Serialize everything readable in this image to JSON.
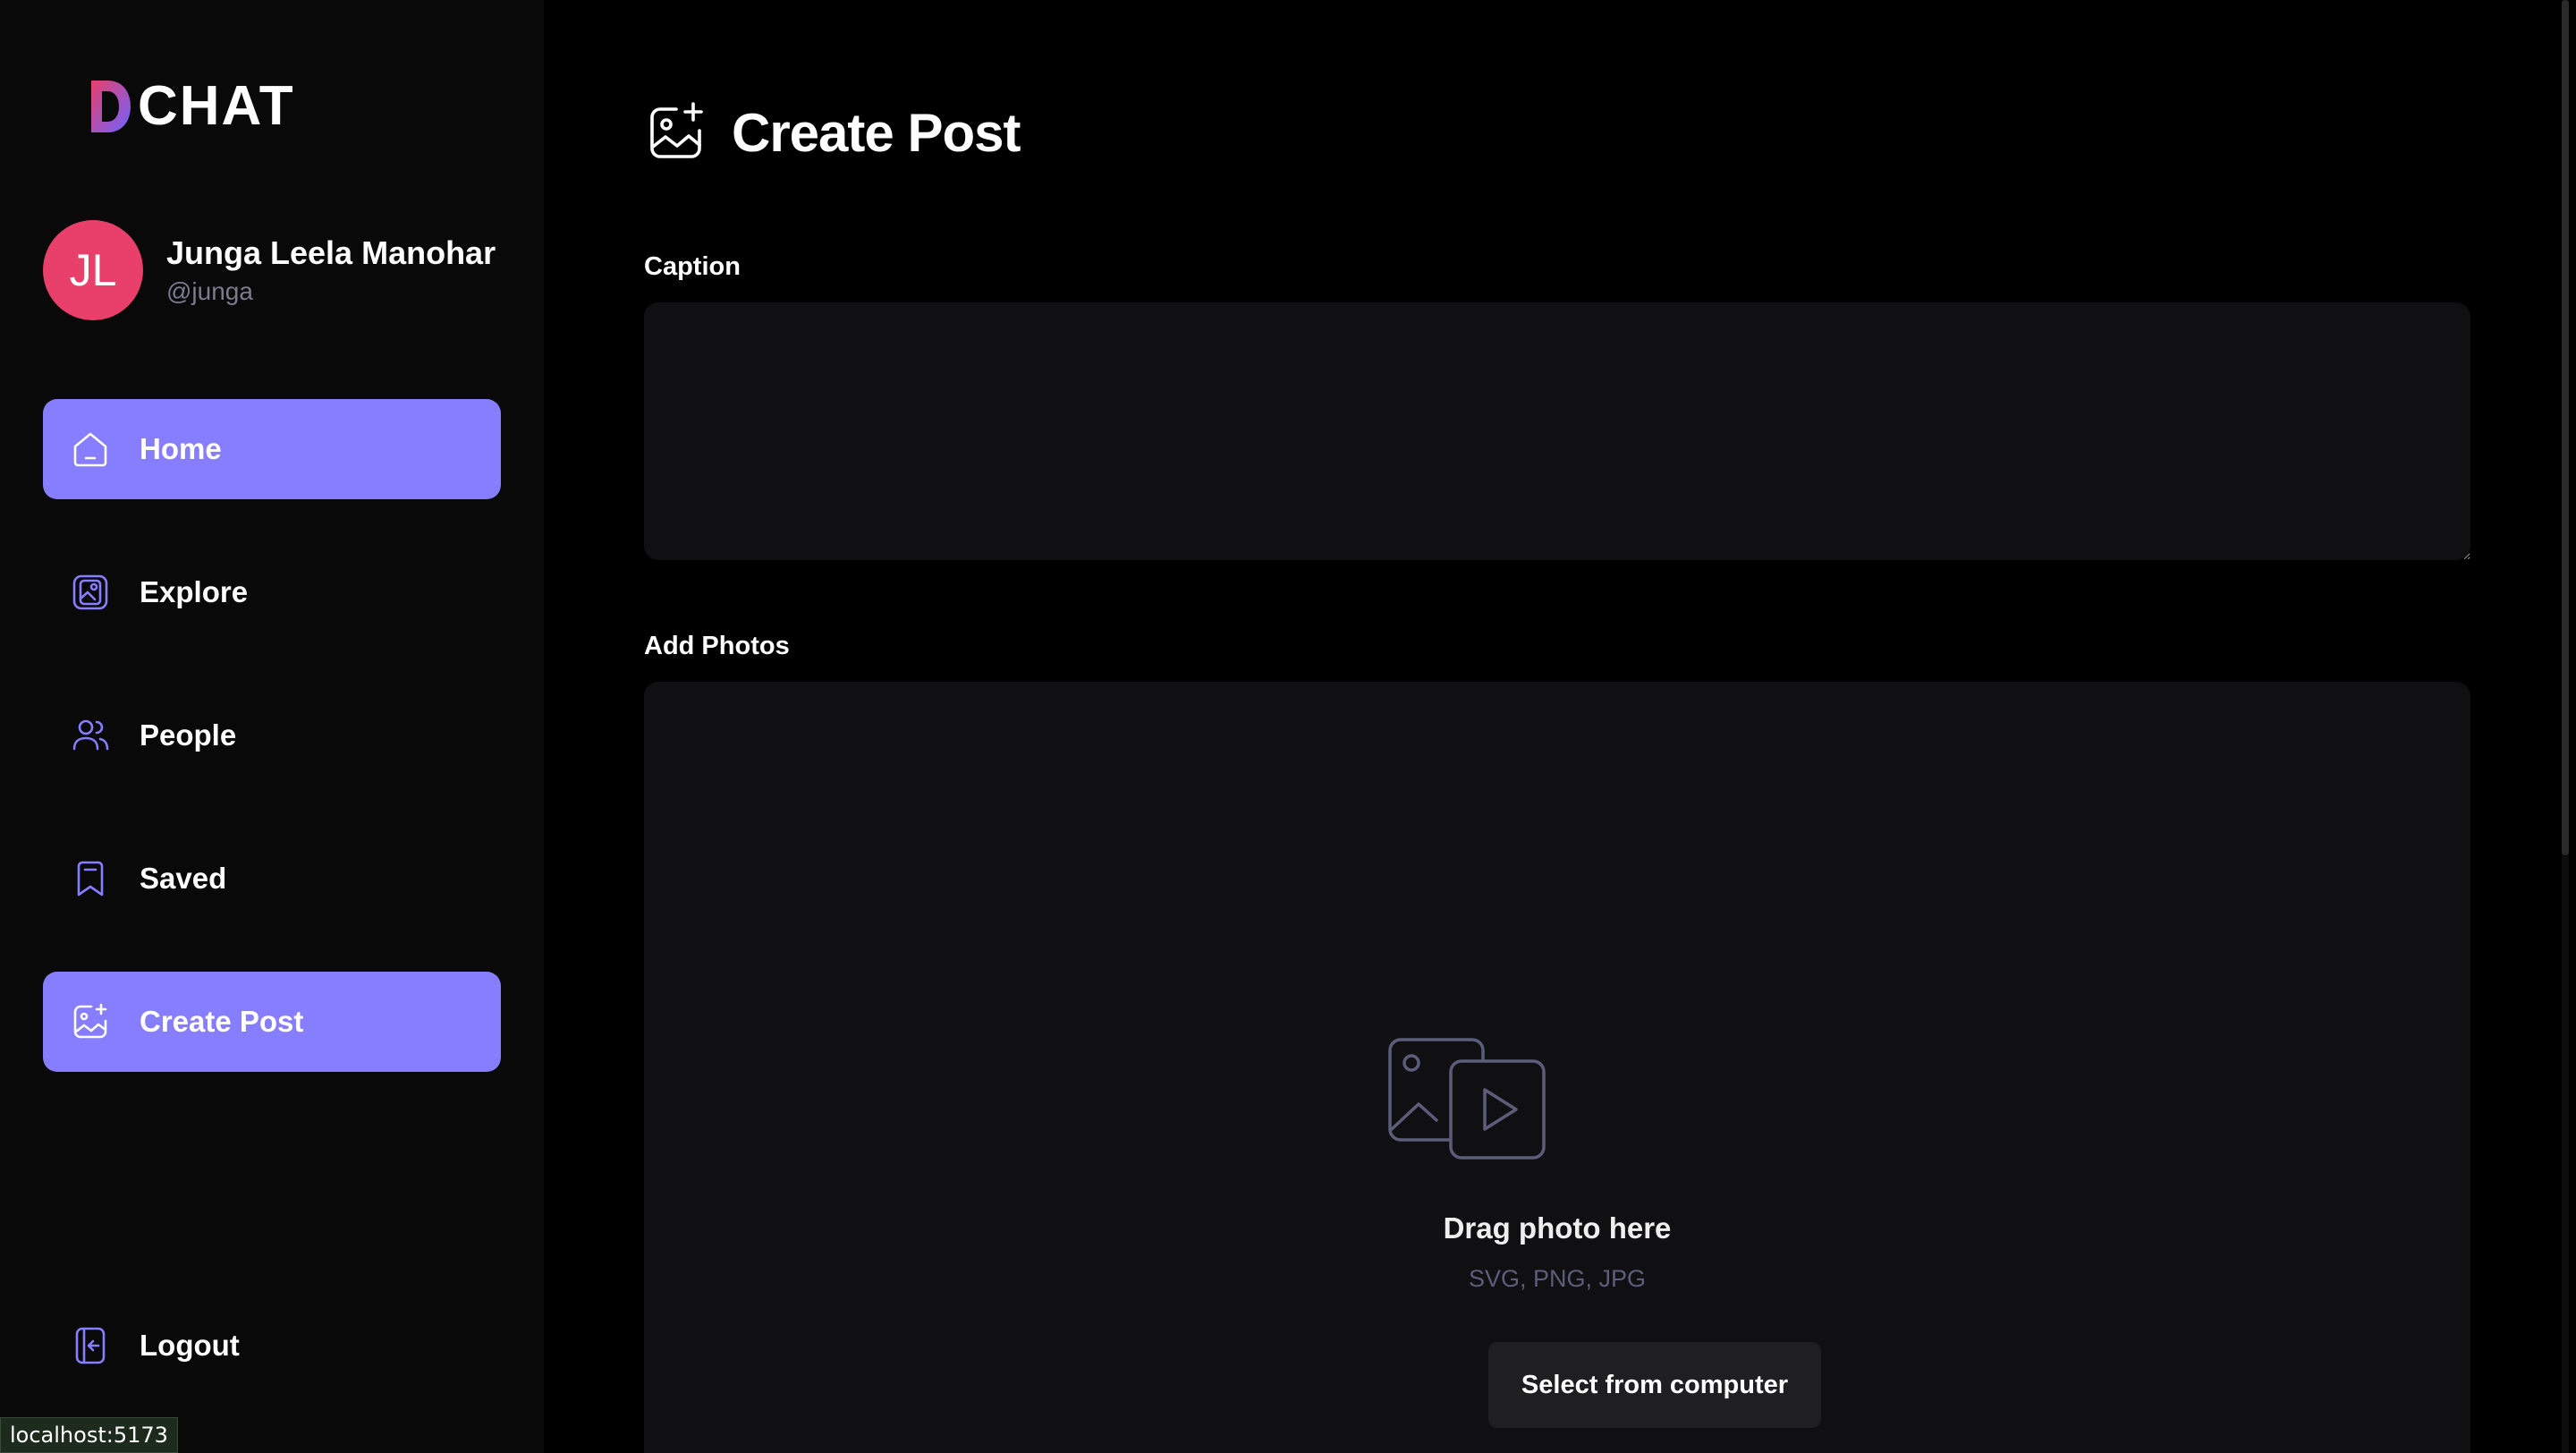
{
  "app": {
    "logo_text": "CHAT",
    "colors": {
      "accent": "#877eff",
      "avatar": "#e8406a",
      "background": "#000000",
      "sidebar": "#09090a",
      "input_bg": "#101012"
    }
  },
  "user": {
    "initials": "JL",
    "name": "Junga Leela Manohar",
    "handle": "@junga"
  },
  "sidebar": {
    "items": [
      {
        "label": "Home",
        "icon": "home-icon",
        "active": true
      },
      {
        "label": "Explore",
        "icon": "gallery-icon",
        "active": false
      },
      {
        "label": "People",
        "icon": "people-icon",
        "active": false
      },
      {
        "label": "Saved",
        "icon": "bookmark-icon",
        "active": false
      },
      {
        "label": "Create Post",
        "icon": "gallery-add-icon",
        "active": true
      }
    ],
    "logout": "Logout"
  },
  "main": {
    "title": "Create Post",
    "caption_label": "Caption",
    "caption_value": "",
    "photos_label": "Add Photos",
    "drop_title": "Drag photo here",
    "drop_sub": "SVG, PNG, JPG",
    "select_button": "Select from computer"
  },
  "status_bar": {
    "url": "localhost:5173"
  }
}
